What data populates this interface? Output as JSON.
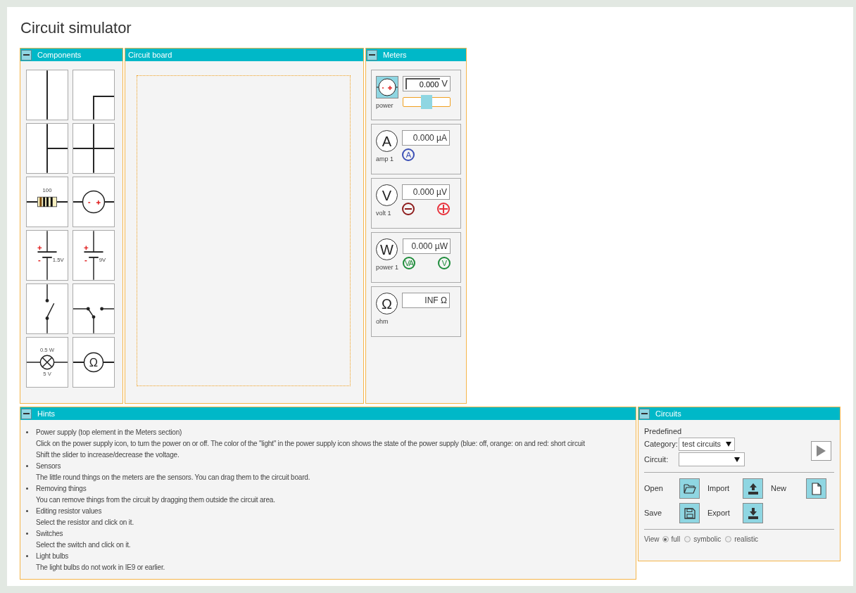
{
  "title": "Circuit simulator",
  "components_panel": {
    "title": "Components",
    "expanded": true,
    "tiles": [
      {
        "kind": "straight"
      },
      {
        "kind": "corner"
      },
      {
        "kind": "tee"
      },
      {
        "kind": "cross"
      },
      {
        "kind": "resistor",
        "label": "100"
      },
      {
        "kind": "source"
      },
      {
        "kind": "battery",
        "label": "1.5V"
      },
      {
        "kind": "battery",
        "label": "9V"
      },
      {
        "kind": "switch"
      },
      {
        "kind": "changeover"
      },
      {
        "kind": "lamp",
        "label": "0.5 W",
        "sublabel": "5 V"
      },
      {
        "kind": "ohm",
        "symbol": "Ω"
      }
    ]
  },
  "board_panel": {
    "title": "Circuit board"
  },
  "meters_panel": {
    "title": "Meters",
    "expanded": true,
    "meters": [
      {
        "kind": "power",
        "label": "power",
        "value": "0.000",
        "unit": "V",
        "level": 0.5
      },
      {
        "kind": "meter",
        "symbol": "A",
        "label": "amp 1",
        "value": "0.000 µA",
        "sensors": [
          {
            "kind": "text",
            "text": "A",
            "color": "#3b4fb5"
          }
        ]
      },
      {
        "kind": "meter",
        "symbol": "V",
        "label": "volt 1",
        "value": "0.000 µV",
        "sensors": [
          {
            "kind": "minus",
            "color": "#8e1b1b"
          },
          {
            "kind": "plus",
            "color": "#e8303a"
          }
        ]
      },
      {
        "kind": "meter",
        "symbol": "W",
        "label": "power 1",
        "value": "0.000 µW",
        "sensors": [
          {
            "kind": "text",
            "text": "VA",
            "color": "#1e8c3a"
          },
          {
            "kind": "text",
            "text": "V",
            "color": "#1e8c3b"
          }
        ]
      },
      {
        "kind": "meter",
        "symbol": "Ω",
        "label": "ohm",
        "value": "INF Ω"
      }
    ]
  },
  "hints_panel": {
    "title": "Hints",
    "expanded": true,
    "items": [
      {
        "title": "Power supply (top element in the Meters section)",
        "lines": [
          "Click on the power supply icon, to turn the power on or off. The color of the \"light\" in the power supply icon shows the state of the power supply (blue: off, orange: on and red: short circuit",
          "Shift the slider to increase/decrease the voltage."
        ]
      },
      {
        "title": "Sensors",
        "lines": [
          "The little round things on the meters are the sensors. You can drag them to the circuit board."
        ]
      },
      {
        "title": "Removing things",
        "lines": [
          "You can remove things from the circuit by dragging them outside the circuit area."
        ]
      },
      {
        "title": "Editing resistor values",
        "lines": [
          "Select the resistor and click on it."
        ]
      },
      {
        "title": "Switches",
        "lines": [
          "Select the switch and click on it."
        ]
      },
      {
        "title": "Light bulbs",
        "lines": [
          "The light bulbs do not work in IE9 or earlier."
        ]
      }
    ]
  },
  "circuits_panel": {
    "title": "Circuits",
    "expanded": true,
    "heading": "Predefined",
    "category": {
      "label": "Category:",
      "value": "test circuits"
    },
    "circuit": {
      "label": "Circuit:"
    },
    "actions": [
      {
        "kind": "open",
        "label": "Open"
      },
      {
        "kind": "import",
        "label": "Import"
      },
      {
        "kind": "new",
        "label": "New"
      },
      {
        "kind": "save",
        "label": "Save"
      },
      {
        "kind": "export",
        "label": "Export"
      }
    ],
    "view": {
      "label": "View",
      "options": [
        {
          "label": "full",
          "selected": true
        },
        {
          "label": "symbolic",
          "selected": false
        },
        {
          "label": "realistic",
          "selected": false
        }
      ]
    }
  }
}
